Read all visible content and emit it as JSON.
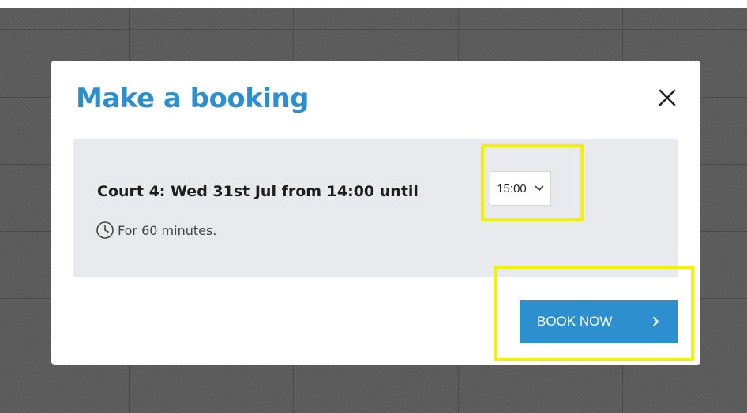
{
  "modal": {
    "title": "Make a booking",
    "booking_summary": "Court 4: Wed 31st Jul from 14:00 until",
    "end_time_select": {
      "selected": "15:00"
    },
    "duration": "For 60 minutes.",
    "book_button_label": "BOOK NOW"
  },
  "icons": {
    "close": "close-icon",
    "clock": "clock-icon",
    "dropdown": "chevron-down-icon",
    "button_arrow": "chevron-right-icon"
  },
  "colors": {
    "accent": "#2e8fcf",
    "panel_background": "#e9eaee",
    "highlight": "#f2f200",
    "backdrop": "#5a5a5a"
  }
}
